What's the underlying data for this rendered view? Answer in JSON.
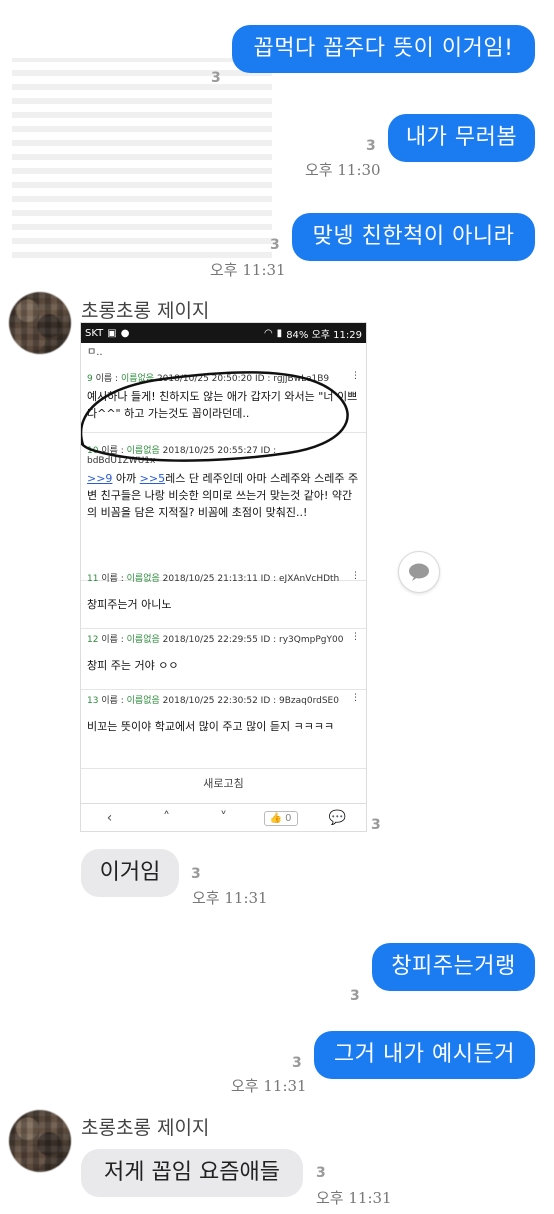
{
  "messages": [
    {
      "side": "sent",
      "text": "꼽먹다 꼽주다 뜻이 이거임!",
      "count": "3"
    },
    {
      "side": "sent",
      "text": "내가 무러봄",
      "count": "3",
      "time": "오후 11:30"
    },
    {
      "side": "sent",
      "text": "맞넹 친한척이 아니라",
      "count": "3",
      "time": "오후 11:31"
    },
    {
      "side": "recv",
      "sender": "초롱초롱 제이지"
    },
    {
      "side": "recv",
      "text": "이거임",
      "count": "3",
      "time": "오후 11:31"
    },
    {
      "side": "sent",
      "text": "창피주는거랭",
      "count": "3"
    },
    {
      "side": "sent",
      "text": "그거 내가 예시든거",
      "count": "3",
      "time": "오후 11:31"
    },
    {
      "side": "recv",
      "sender": "초롱초롱 제이지",
      "text": "저게 꼽임 요즘애들",
      "count": "3",
      "time": "오후 11:31"
    }
  ],
  "screenshot": {
    "status_left": "SKT",
    "status_right": "84% 오후 11:29",
    "top_fragment": "ㅁ..",
    "posts": [
      {
        "num": "9",
        "label": "이름 : ",
        "name": "이름없음",
        "date": "2018/10/25 20:50:20 ID : rgjjBwLe1B9",
        "body": "예시하나 들게! 친하지도 않는 애가 갑자기 와서는 \"너 이쁘다^^\" 하고 가는것도 꼽이라던데.."
      },
      {
        "num": "10",
        "label": "이름 : ",
        "name": "이름없음",
        "date": "2018/10/25 20:55:27 ID :",
        "id2": "bdBdU1ZWU1x",
        "link1": ">>9",
        "mid1": " 아까 ",
        "link2": ">>5",
        "body": "레스 단 레주인데 아마 스레주와 스레주 주변 친구들은 나랑 비슷한 의미로 쓰는거 맞는것 같아! 약간의 비꼼을 담은 지적질? 비꼼에 초점이 맞춰진..!"
      },
      {
        "num": "11",
        "label": "이름 : ",
        "name": "이름없음",
        "date": "2018/10/25 21:13:11 ID : eJXAnVcHDth",
        "body": "창피주는거 아니노"
      },
      {
        "num": "12",
        "label": "이름 : ",
        "name": "이름없음",
        "date": "2018/10/25 22:29:55 ID : ry3QmpPgY00",
        "body": "창피 주는 거야 ㅇㅇ"
      },
      {
        "num": "13",
        "label": "이름 : ",
        "name": "이름없음",
        "date": "2018/10/25 22:30:52 ID : 9Bzaq0rdSE0",
        "body": "비꼬는 뜻이야 학교에서 많이 주고 많이 듣지 ㅋㅋㅋㅋ"
      }
    ],
    "refresh_label": "새로고침",
    "nav": {
      "back": "‹",
      "up": "˄",
      "down": "˅",
      "like": "👍 0",
      "comment": "💬"
    }
  },
  "screenshot_count": "3",
  "colors": {
    "sent": "#1a7cf0",
    "recv": "#e9e9eb"
  }
}
